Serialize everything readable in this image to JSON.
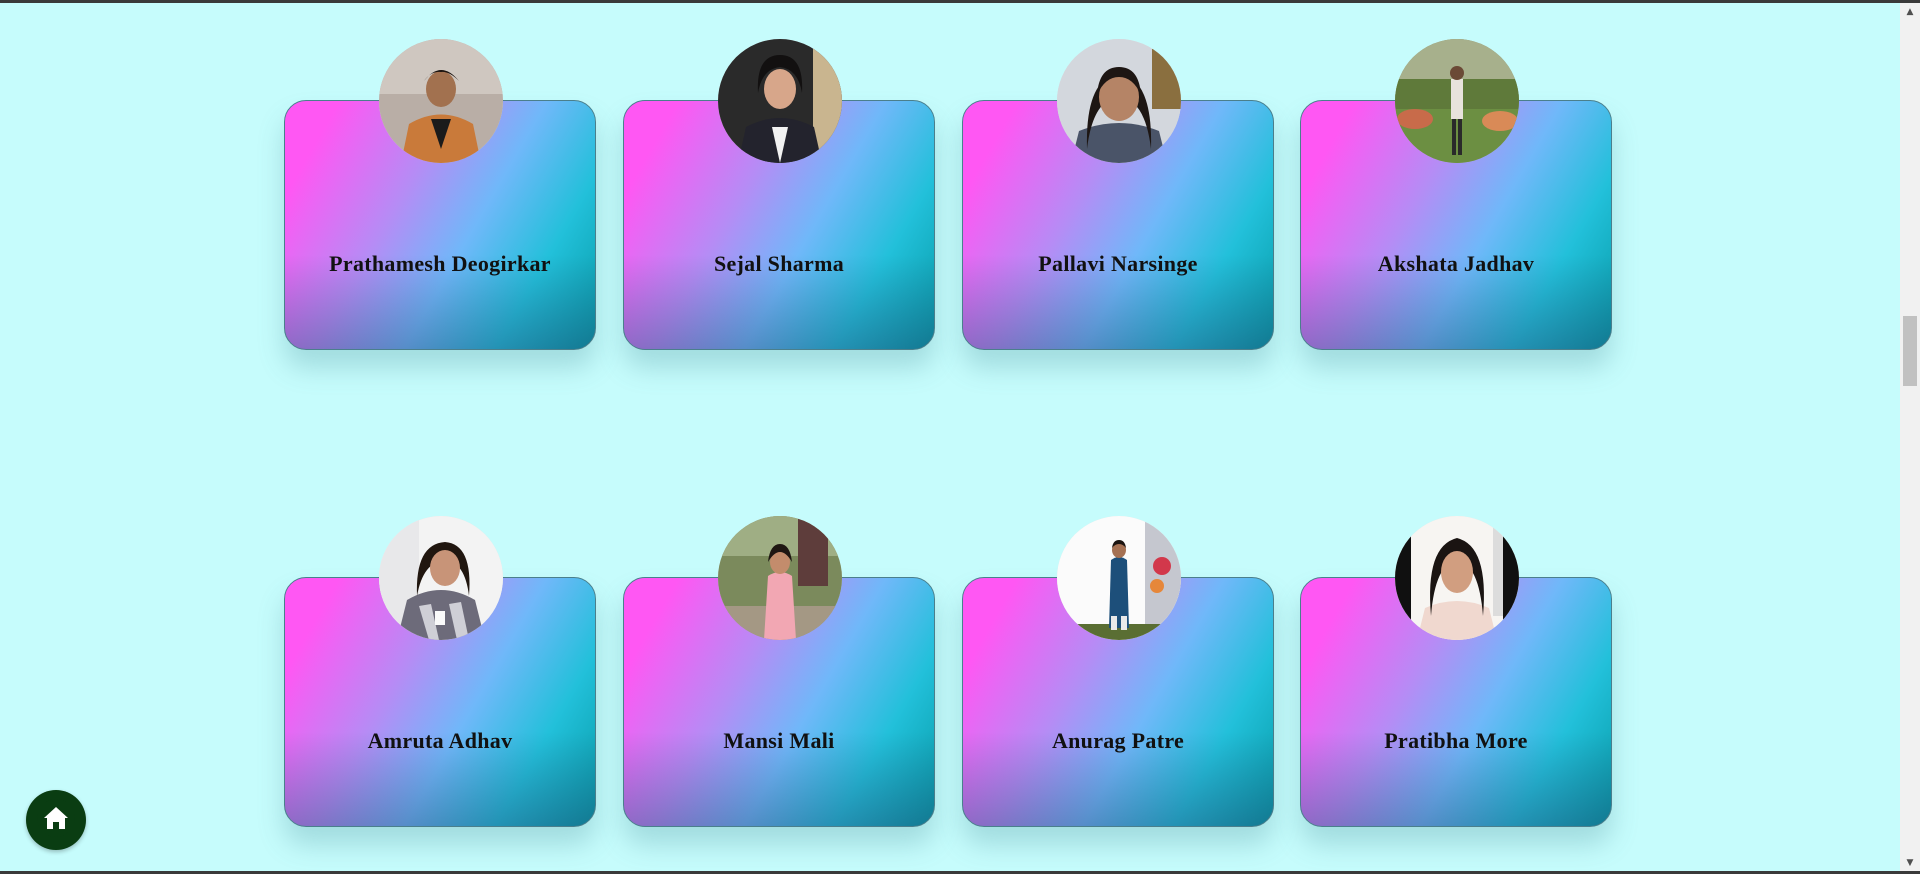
{
  "members": [
    {
      "name": "Prathamesh Deogirkar"
    },
    {
      "name": "Sejal Sharma"
    },
    {
      "name": "Pallavi Narsinge"
    },
    {
      "name": "Akshata Jadhav"
    },
    {
      "name": "Amruta Adhav"
    },
    {
      "name": "Mansi Mali"
    },
    {
      "name": "Anurag Patre"
    },
    {
      "name": "Pratibha More"
    }
  ],
  "home_button": {
    "icon": "home-icon"
  },
  "colors": {
    "page_background": "#c6fcfc",
    "card_gradient_start": "#ff57f3",
    "card_gradient_end": "#069aa5",
    "home_button_bg": "#0a3d12"
  }
}
